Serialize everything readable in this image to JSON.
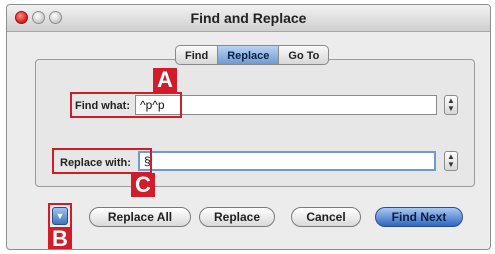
{
  "window": {
    "title": "Find and Replace"
  },
  "tabs": [
    {
      "label": "Find",
      "selected": false
    },
    {
      "label": "Replace",
      "selected": true
    },
    {
      "label": "Go To",
      "selected": false
    }
  ],
  "find": {
    "label": "Find what:",
    "value": "^p^p"
  },
  "replace": {
    "label": "Replace with:",
    "value": "§"
  },
  "buttons": {
    "replace_all": "Replace All",
    "replace": "Replace",
    "cancel": "Cancel",
    "find_next": "Find Next"
  },
  "callouts": {
    "a": "A",
    "b": "B",
    "c": "C"
  },
  "colors": {
    "callout": "#d21c2a",
    "accent": "#3f74c2"
  },
  "icons": {
    "expand": "triangle-down-icon",
    "stepper": "up-down-stepper-icon"
  }
}
